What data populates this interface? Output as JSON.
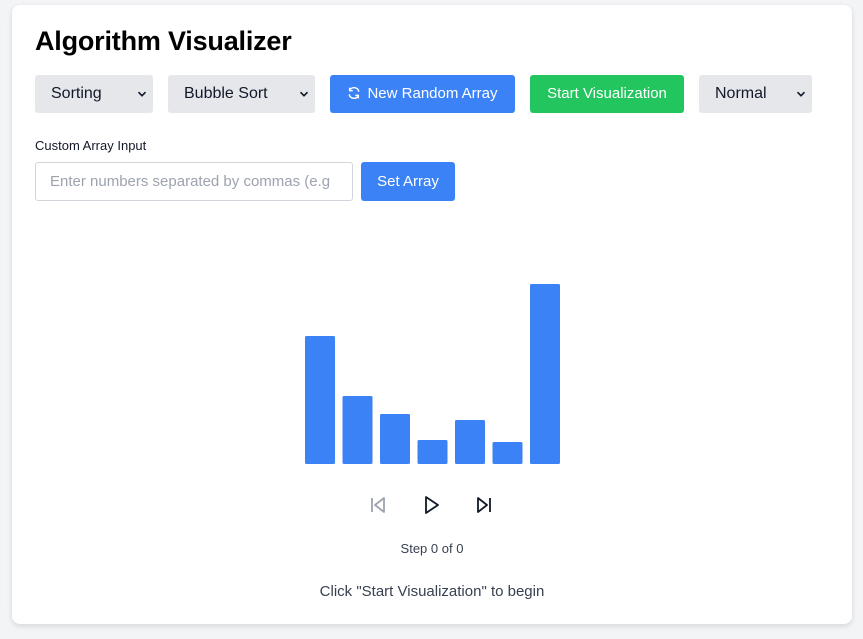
{
  "app": {
    "title": "Algorithm Visualizer"
  },
  "toolbar": {
    "category_select": {
      "value": "Sorting"
    },
    "algorithm_select": {
      "value": "Bubble Sort"
    },
    "random_button": {
      "label": "New Random Array",
      "icon": "refresh-icon"
    },
    "start_button": {
      "label": "Start Visualization"
    },
    "speed_select": {
      "value": "Normal"
    }
  },
  "custom_input": {
    "label": "Custom Array Input",
    "placeholder": "Enter numbers separated by commas (e.g",
    "value": "",
    "set_button_label": "Set Array"
  },
  "bars": {
    "color": "#3b82f6",
    "values": [
      64,
      34,
      25,
      12,
      22,
      11,
      90
    ]
  },
  "playback": {
    "prev_icon": "skip-back-icon",
    "play_icon": "play-icon",
    "next_icon": "skip-forward-icon",
    "step_text": "Step 0 of 0"
  },
  "status": {
    "message": "Click \"Start Visualization\" to begin"
  },
  "colors": {
    "primary": "#3b82f6",
    "success": "#22c55e",
    "select_bg": "#e5e7eb"
  }
}
